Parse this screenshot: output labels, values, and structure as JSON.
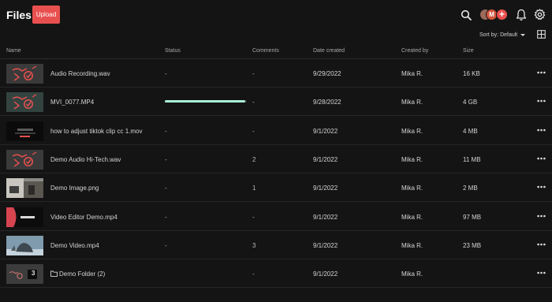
{
  "header": {
    "title": "Files",
    "upload_label": "Upload",
    "icons": [
      "search-icon",
      "bell-icon",
      "gear-icon"
    ],
    "avatar_letter": "M",
    "add_member_symbol": "+",
    "sort_label": "Sort by: Default"
  },
  "colors": {
    "accent": "#e8504f",
    "progress": "#a8f0d8",
    "background": "#141414"
  },
  "table": {
    "columns": [
      "Name",
      "Status",
      "Comments",
      "Date created",
      "Created by",
      "Size"
    ],
    "rows": [
      {
        "name": "Audio Recording.wav",
        "status": "-",
        "comments": "-",
        "date": "9/29/2022",
        "by": "Mika R.",
        "size": "16 KB",
        "thumb": "audio"
      },
      {
        "name": "MVI_0077.MP4",
        "status": "",
        "progress": 0.98,
        "comments": "-",
        "date": "9/28/2022",
        "by": "Mika R.",
        "size": "4 GB",
        "thumb": "audio-teal"
      },
      {
        "name": "how to adjust tiktok clip cc 1.mov",
        "status": "-",
        "comments": "-",
        "date": "9/1/2022",
        "by": "Mika R.",
        "size": "4 MB",
        "thumb": "dark-video"
      },
      {
        "name": "Demo Audio Hi-Tech.wav",
        "status": "-",
        "comments": "2",
        "date": "9/1/2022",
        "by": "Mika R.",
        "size": "11 MB",
        "thumb": "audio"
      },
      {
        "name": "Demo Image.png",
        "status": "-",
        "comments": "1",
        "date": "9/1/2022",
        "by": "Mika R.",
        "size": "2 MB",
        "thumb": "image"
      },
      {
        "name": "Video Editor Demo.mp4",
        "status": "-",
        "comments": "-",
        "date": "9/1/2022",
        "by": "Mika R.",
        "size": "97 MB",
        "thumb": "editor"
      },
      {
        "name": "Demo Video.mp4",
        "status": "-",
        "comments": "3",
        "date": "9/1/2022",
        "by": "Mika R.",
        "size": "23 MB",
        "thumb": "video"
      },
      {
        "name": "Demo Folder (2)",
        "status": "",
        "comments": "-",
        "date": "9/1/2022",
        "by": "Mika R.",
        "size": "",
        "thumb": "folder",
        "folder_count": "3"
      }
    ]
  }
}
